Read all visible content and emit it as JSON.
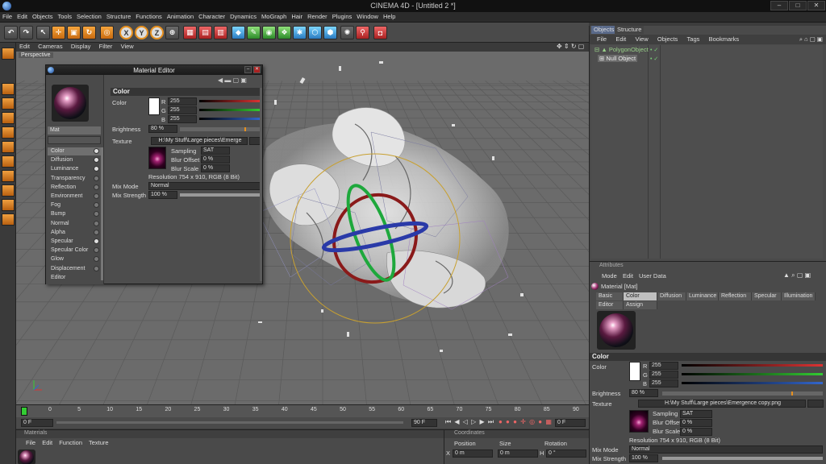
{
  "window": {
    "title": "CINEMA 4D - [Untitled 2 *]"
  },
  "menubar": [
    "File",
    "Edit",
    "Objects",
    "Tools",
    "Selection",
    "Structure",
    "Functions",
    "Animation",
    "Character",
    "Dynamics",
    "MoGraph",
    "Hair",
    "Render",
    "Plugins",
    "Window",
    "Help"
  ],
  "toolbar": {
    "axis_buttons": [
      "X",
      "Y",
      "Z"
    ]
  },
  "viewport": {
    "menu": [
      "Edit",
      "Cameras",
      "Display",
      "Filter",
      "View"
    ],
    "label": "Perspective"
  },
  "timeline": {
    "ticks": [
      "0",
      "5",
      "10",
      "15",
      "20",
      "25",
      "30",
      "35",
      "40",
      "45",
      "50",
      "55",
      "60",
      "65",
      "70",
      "75",
      "80",
      "85",
      "90"
    ],
    "start_field": "0 F",
    "end_field": "90 F",
    "current_field": "0 F"
  },
  "materials_panel": {
    "header": "Materials",
    "menu": [
      "File",
      "Edit",
      "Function",
      "Texture"
    ]
  },
  "coords_panel": {
    "header": "Coordinates",
    "columns": [
      "Position",
      "Size",
      "Rotation"
    ],
    "row": {
      "axis": "X",
      "pos": "0 m",
      "size": "0 m",
      "rot_axis": "H",
      "rot": "0 °"
    }
  },
  "objects_panel": {
    "tabs": [
      "Objects",
      "Structure"
    ],
    "menu": [
      "File",
      "Edit",
      "View",
      "Objects",
      "Tags",
      "Bookmarks"
    ],
    "items": [
      "PolygonObject",
      "Null Object"
    ]
  },
  "attributes_panel": {
    "header": "Attributes",
    "menu": [
      "Mode",
      "Edit",
      "User Data"
    ],
    "material_name": "Material [Mat]",
    "tabs_row1": [
      "Basic",
      "Color",
      "Diffusion",
      "Luminance",
      "Reflection",
      "Specular",
      "Illumination"
    ],
    "tabs_row2": [
      "Editor",
      "Assign"
    ],
    "section": "Color",
    "color_label": "Color",
    "r_label": "R",
    "r_value": "255",
    "g_label": "G",
    "g_value": "255",
    "b_label": "B",
    "b_value": "255",
    "brightness_label": "Brightness",
    "brightness_value": "80 %",
    "texture_label": "Texture",
    "texture_path": "H:\\My Stuff\\Large pieces\\Emergence copy.png",
    "sampling_label": "Sampling",
    "sampling_value": "SAT",
    "blur_offset_label": "Blur Offset",
    "blur_offset_value": "0 %",
    "blur_scale_label": "Blur Scale",
    "blur_scale_value": "0 %",
    "resolution": "Resolution 754 x 910, RGB (8 Bit)",
    "mix_mode_label": "Mix Mode",
    "mix_mode_value": "Normal",
    "mix_strength_label": "Mix Strength",
    "mix_strength_value": "100 %"
  },
  "material_editor": {
    "title": "Material Editor",
    "mat_name": "Mat",
    "section": "Color",
    "channels": [
      {
        "name": "Color",
        "on": true
      },
      {
        "name": "Diffusion",
        "on": true
      },
      {
        "name": "Luminance",
        "on": true
      },
      {
        "name": "Transparency",
        "on": false
      },
      {
        "name": "Reflection",
        "on": false
      },
      {
        "name": "Environment",
        "on": false
      },
      {
        "name": "Fog",
        "on": false
      },
      {
        "name": "Bump",
        "on": false
      },
      {
        "name": "Normal",
        "on": false
      },
      {
        "name": "Alpha",
        "on": false
      },
      {
        "name": "Specular",
        "on": true
      },
      {
        "name": "Specular Color",
        "on": false
      },
      {
        "name": "Glow",
        "on": false
      },
      {
        "name": "Displacement",
        "on": false
      },
      {
        "name": "Editor",
        "on": null
      }
    ],
    "color_label": "Color",
    "r_label": "R",
    "r_value": "255",
    "g_label": "G",
    "g_value": "255",
    "b_label": "B",
    "b_value": "255",
    "brightness_label": "Brightness",
    "brightness_value": "80 %",
    "texture_label": "Texture",
    "texture_path": "H:\\My Stuff\\Large pieces\\Emerge",
    "sampling_label": "Sampling",
    "sampling_value": "SAT",
    "blur_offset_label": "Blur Offset",
    "blur_offset_value": "0 %",
    "blur_scale_label": "Blur Scale",
    "blur_scale_value": "0 %",
    "resolution": "Resolution 754 x 910, RGB (8 Bit)",
    "mix_mode_label": "Mix Mode",
    "mix_mode_value": "Normal",
    "mix_strength_label": "Mix Strength",
    "mix_strength_value": "100 %"
  },
  "colors": {
    "accent_orange": "#e69020",
    "red_channel": "#d33",
    "green_channel": "#3c3",
    "blue_channel": "#36c"
  }
}
